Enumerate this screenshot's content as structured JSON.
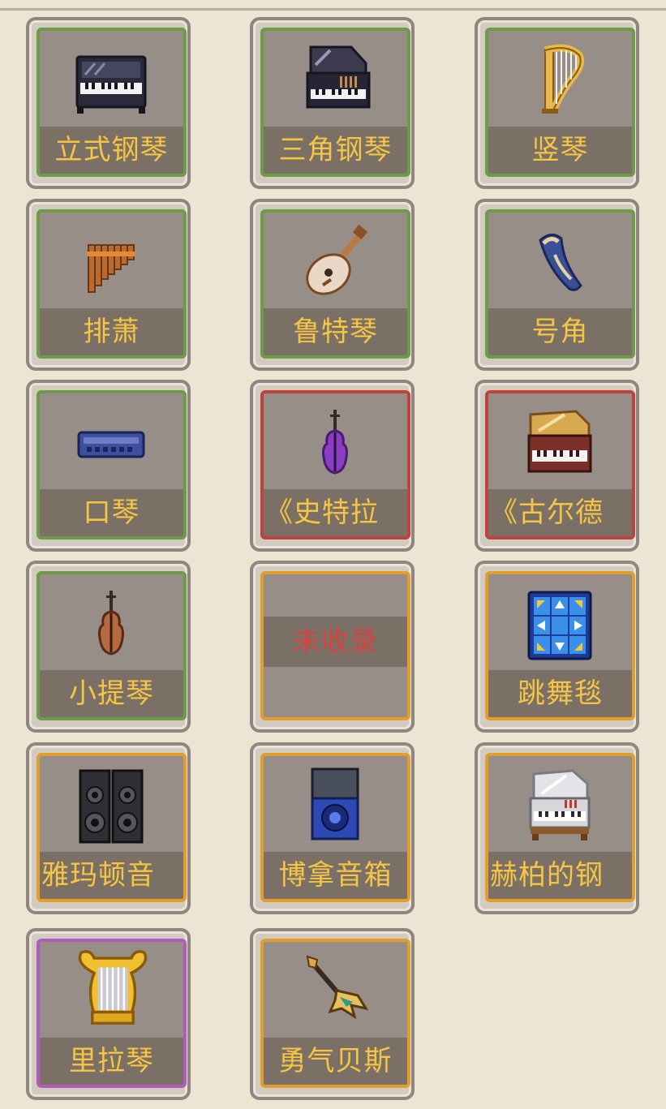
{
  "instruments": [
    {
      "label": "立式钢琴",
      "frame": "green",
      "icon": "upright-piano-icon"
    },
    {
      "label": "三角钢琴",
      "frame": "green",
      "icon": "grand-piano-icon"
    },
    {
      "label": "竖琴",
      "frame": "green",
      "icon": "harp-icon"
    },
    {
      "label": "排萧",
      "frame": "green",
      "icon": "pan-flute-icon"
    },
    {
      "label": "鲁特琴",
      "frame": "green",
      "icon": "lute-icon"
    },
    {
      "label": "号角",
      "frame": "green",
      "icon": "horn-icon"
    },
    {
      "label": "口琴",
      "frame": "green",
      "icon": "harmonica-icon"
    },
    {
      "label": "《史特拉",
      "frame": "red",
      "icon": "purple-cello-icon"
    },
    {
      "label": "《古尔德",
      "frame": "red",
      "icon": "golden-piano-icon"
    },
    {
      "label": "小提琴",
      "frame": "green",
      "icon": "violin-icon"
    },
    {
      "label": "未收录",
      "frame": "orange",
      "icon": "none"
    },
    {
      "label": "跳舞毯",
      "frame": "orange",
      "icon": "dance-mat-icon"
    },
    {
      "label": "雅玛顿音",
      "frame": "orange",
      "icon": "speakers-icon"
    },
    {
      "label": "博拿音箱",
      "frame": "orange",
      "icon": "speaker-box-icon"
    },
    {
      "label": "赫柏的钢",
      "frame": "orange",
      "icon": "white-piano-icon"
    },
    {
      "label": "里拉琴",
      "frame": "purple",
      "icon": "lyre-icon"
    },
    {
      "label": "勇气贝斯",
      "frame": "orange",
      "icon": "bass-guitar-icon"
    }
  ],
  "colors": {
    "background": "#ece5d4",
    "label_text": "#f5c543",
    "frame_green": "#6e9b4a",
    "frame_red": "#c1413e",
    "frame_orange": "#e39d2c",
    "frame_purple": "#b35bbd",
    "unrecorded_text": "#d8433d"
  }
}
